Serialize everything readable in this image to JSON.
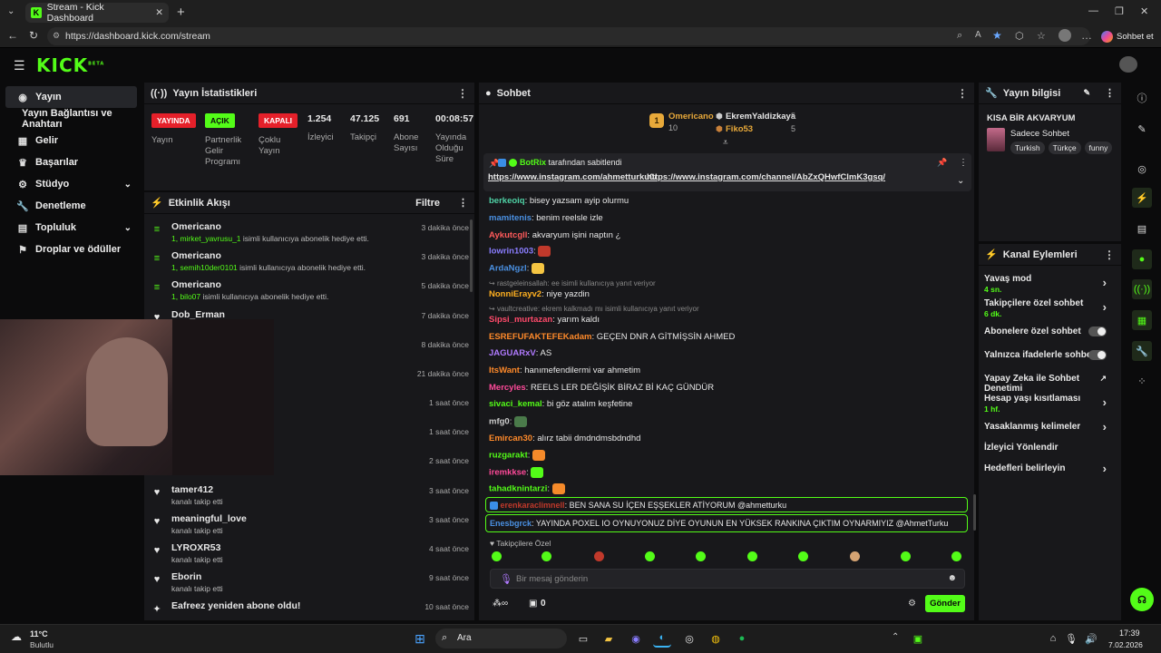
{
  "browser": {
    "tab_title": "Stream - Kick Dashboard",
    "url": "https://dashboard.kick.com/stream",
    "copilot_label": "Sohbet et"
  },
  "brand": {
    "logo": "KICK",
    "beta": "BETA",
    "accent": "#53fc18"
  },
  "sidebar": {
    "items": [
      {
        "label": "Yayın",
        "icon": "broadcast-icon"
      },
      {
        "label": "Yayın Bağlantısı ve Anahtarı",
        "icon": ""
      },
      {
        "label": "Gelir",
        "icon": "money-icon"
      },
      {
        "label": "Başarılar",
        "icon": "trophy-icon"
      },
      {
        "label": "Stüdyo",
        "icon": "studio-icon"
      },
      {
        "label": "Denetleme",
        "icon": "wrench-icon"
      },
      {
        "label": "Topluluk",
        "icon": "community-icon"
      },
      {
        "label": "Droplar ve ödüller",
        "icon": "gift-icon"
      }
    ]
  },
  "stats": {
    "title": "Yayın İstatistikleri",
    "badges": [
      {
        "badge": "YAYINDA",
        "label": "Yayın"
      },
      {
        "badge": "AÇIK",
        "label": "Partnerlik Gelir Programı"
      },
      {
        "badge": "KAPALI",
        "label": "Çoklu Yayın"
      }
    ],
    "numbers": [
      {
        "value": "1.254",
        "label": "İzleyici"
      },
      {
        "value": "47.125",
        "label": "Takipçi"
      },
      {
        "value": "691",
        "label": "Abone Sayısı"
      },
      {
        "value": "00:08:57",
        "label": "Yayında Olduğu Süre"
      }
    ]
  },
  "activity": {
    "title": "Etkinlik Akışı",
    "filter": "Filtre",
    "rows": [
      {
        "name": "Omericano",
        "sub_green": "1, mirket_yavrusu_1",
        "sub": " isimli kullanıcıya abonelik hediye etti.",
        "time": "3 dakika önce"
      },
      {
        "name": "Omericano",
        "sub_green": "1, semih10der0101",
        "sub": " isimli kullanıcıya abonelik hediye etti.",
        "time": "3 dakika önce"
      },
      {
        "name": "Omericano",
        "sub_green": "1, bilo07",
        "sub": " isimli kullanıcıya abonelik hediye etti.",
        "time": "5 dakika önce"
      },
      {
        "name": "Dob_Erman",
        "sub_green": "",
        "sub": "",
        "time": "7 dakika önce"
      },
      {
        "name": "",
        "sub_green": "",
        "sub": "",
        "time": "8 dakika önce"
      },
      {
        "name": "",
        "sub_green": "",
        "sub": "",
        "time": "21 dakika önce"
      },
      {
        "name": "",
        "sub_green": "",
        "sub": "",
        "time": "1 saat önce"
      },
      {
        "name": "",
        "sub_green": "",
        "sub": "",
        "time": "1 saat önce"
      },
      {
        "name": "",
        "sub_green": "",
        "sub": "",
        "time": "2 saat önce"
      },
      {
        "name": "tamer412",
        "sub_green": "",
        "sub": "kanalı takip etti",
        "time": "3 saat önce"
      },
      {
        "name": "meaningful_love",
        "sub_green": "",
        "sub": "kanalı takip etti",
        "time": "3 saat önce"
      },
      {
        "name": "LYROXR53",
        "sub_green": "",
        "sub": "kanalı takip etti",
        "time": "4 saat önce"
      },
      {
        "name": "Eborin",
        "sub_green": "",
        "sub": "kanalı takip etti",
        "time": "9 saat önce"
      },
      {
        "name": "Eafreez yeniden abone oldu!",
        "sub_green": "",
        "sub": "",
        "time": "10 saat önce"
      }
    ]
  },
  "chat": {
    "title": "Sohbet",
    "top_gifters": [
      {
        "name": "Omericano",
        "count": "10"
      },
      {
        "name": "EkremYaldizkaya",
        "count": "5"
      },
      {
        "name": "Fiko53",
        "count": "5"
      }
    ],
    "pinned": {
      "by": "BotRix",
      "by_suffix": " tarafından sabitlendi",
      "link1": "https://www.instagram.com/ahmetturku0/",
      "link2": "https://www.instagram.com/channel/AbZxQHwfClmK3gsq/"
    },
    "messages": [
      {
        "user": "berkeoiq",
        "color": "#4fd1a5",
        "text": ": bisey yazsam ayip olurmu"
      },
      {
        "user": "mamitenis",
        "color": "#4a90e2",
        "text": ": benim reelsle izle"
      },
      {
        "user": "Aykutcgll",
        "color": "#ff5a5a",
        "text": ": akvaryum işini naptın ¿"
      },
      {
        "user": "lowrin1003",
        "color": "#8a7dff",
        "text": ":"
      },
      {
        "user": "ArdaNgzl",
        "color": "#4a90e2",
        "text": ":"
      },
      {
        "reply": "rastgeleinsallah: ee isimli kullanıcıya yanıt veriyor"
      },
      {
        "user": "NonniErayv2",
        "color": "#ffb020",
        "text": ": niye yazdin"
      },
      {
        "reply": "vaultcreative: ekrem kalkmadı mı isimli kullanıcıya yanıt veriyor"
      },
      {
        "user": "Sipsi_murtazan",
        "color": "#ff4a6a",
        "text": ": yarım kaldı"
      },
      {
        "user": "ESREFUFAKTEFEKadam",
        "color": "#ff8a2a",
        "text": ": GEÇEN DNR A GİTMİŞSİN AHMED"
      },
      {
        "user": "JAGUARxV",
        "color": "#b07aff",
        "text": ": AS"
      },
      {
        "user": "ItsWant",
        "color": "#ff8a2a",
        "text": ": hanımefendilermi var ahmetim"
      },
      {
        "user": "Mercyles",
        "color": "#ff4a9a",
        "text": ": REELS LER DEĞİŞİK BİRAZ Bİ KAÇ GÜNDÜR"
      },
      {
        "user": "sivaci_kemal",
        "color": "#53fc18",
        "text": ": bi göz atalım keşfetine"
      },
      {
        "user": "mfg0",
        "color": "#cccccc",
        "text": ":"
      },
      {
        "user": "Emircan30",
        "color": "#ff8a2a",
        "text": ": alırz tabii dmdndmsbdndhd"
      },
      {
        "user": "ruzgarakt",
        "color": "#53fc18",
        "text": ":"
      },
      {
        "user": "iremkkse",
        "color": "#ff4a9a",
        "text": ":"
      },
      {
        "user": "tahadknintarzi",
        "color": "#53fc18",
        "text": ":"
      }
    ],
    "highlighted": [
      {
        "user": "erenkaraclimnell",
        "color": "#c0392b",
        "text": ": BEN SANA SU İÇEN EŞŞEKLER ATİYORUM @ahmetturku"
      },
      {
        "user": "Enesbgrck",
        "color": "#4a90e2",
        "text": ": YAYINDA POXEL IO OYNUYONUZ DİYE OYUNUN EN YÜKSEK RANKINA ÇIKTIM OYNARMIYIZ @AhmetTurku"
      }
    ],
    "emote_section": "Takipçilere Özel",
    "input_placeholder": "Bir mesaj gönderin",
    "points": "0",
    "send_label": "Gönder"
  },
  "stream_info": {
    "title": "Yayın bilgisi",
    "stream_title": "KISA BİR AKVARYUM",
    "category": "Sadece Sohbet",
    "tags": [
      "Turkish",
      "Türkçe",
      "funny"
    ]
  },
  "channel_actions": {
    "title": "Kanal Eylemleri",
    "items": [
      {
        "label": "Yavaş mod",
        "sub": "4 sn.",
        "control": "chevron"
      },
      {
        "label": "Takipçilere özel sohbet",
        "sub": "6 dk.",
        "control": "chevron"
      },
      {
        "label": "Abonelere özel sohbet",
        "sub": "",
        "control": "toggle"
      },
      {
        "label": "Yalnızca ifadelerle sohbet",
        "sub": "",
        "control": "toggle"
      },
      {
        "label": "Yapay Zeka ile Sohbet Denetimi",
        "sub": "",
        "control": "external"
      },
      {
        "label": "Hesap yaşı kısıtlaması",
        "sub": "1 hf.",
        "control": "chevron"
      },
      {
        "label": "Yasaklanmış kelimeler",
        "sub": "",
        "control": "chevron"
      },
      {
        "label": "İzleyici Yönlendir",
        "sub": "",
        "control": ""
      },
      {
        "label": "Hedefleri belirleyin",
        "sub": "",
        "control": "chevron"
      }
    ]
  },
  "taskbar": {
    "weather_temp": "11°C",
    "weather_desc": "Bulutlu",
    "search": "Ara",
    "time": "17:39",
    "date": "7.02.2026"
  }
}
